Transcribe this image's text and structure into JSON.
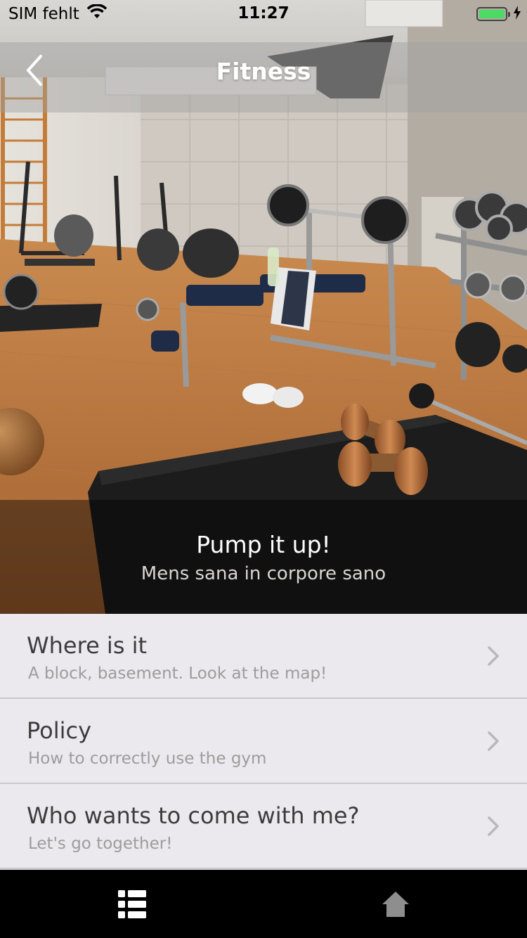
{
  "status_bar": {
    "carrier": "SIM fehlt",
    "time": "11:27",
    "battery_color": "#4cd964"
  },
  "nav": {
    "title": "Fitness",
    "back_icon": "chevron-left-icon"
  },
  "hero": {
    "image": "gym-photo",
    "title": "Pump it up!",
    "subtitle": "Mens sana in corpore sano"
  },
  "list": {
    "items": [
      {
        "title": "Where is it",
        "subtitle": "A block, basement. Look at the map!",
        "icon": "chevron-right-icon"
      },
      {
        "title": "Policy",
        "subtitle": "How to correctly use the gym",
        "icon": "chevron-right-icon"
      },
      {
        "title": "Who wants to come with me?",
        "subtitle": "Let's go together!",
        "icon": "chevron-right-icon"
      }
    ]
  },
  "tab_bar": {
    "tabs": [
      {
        "icon": "list-icon",
        "active": true,
        "color": "#ffffff"
      },
      {
        "icon": "home-icon",
        "active": false,
        "color": "#8e8e8e"
      }
    ]
  }
}
